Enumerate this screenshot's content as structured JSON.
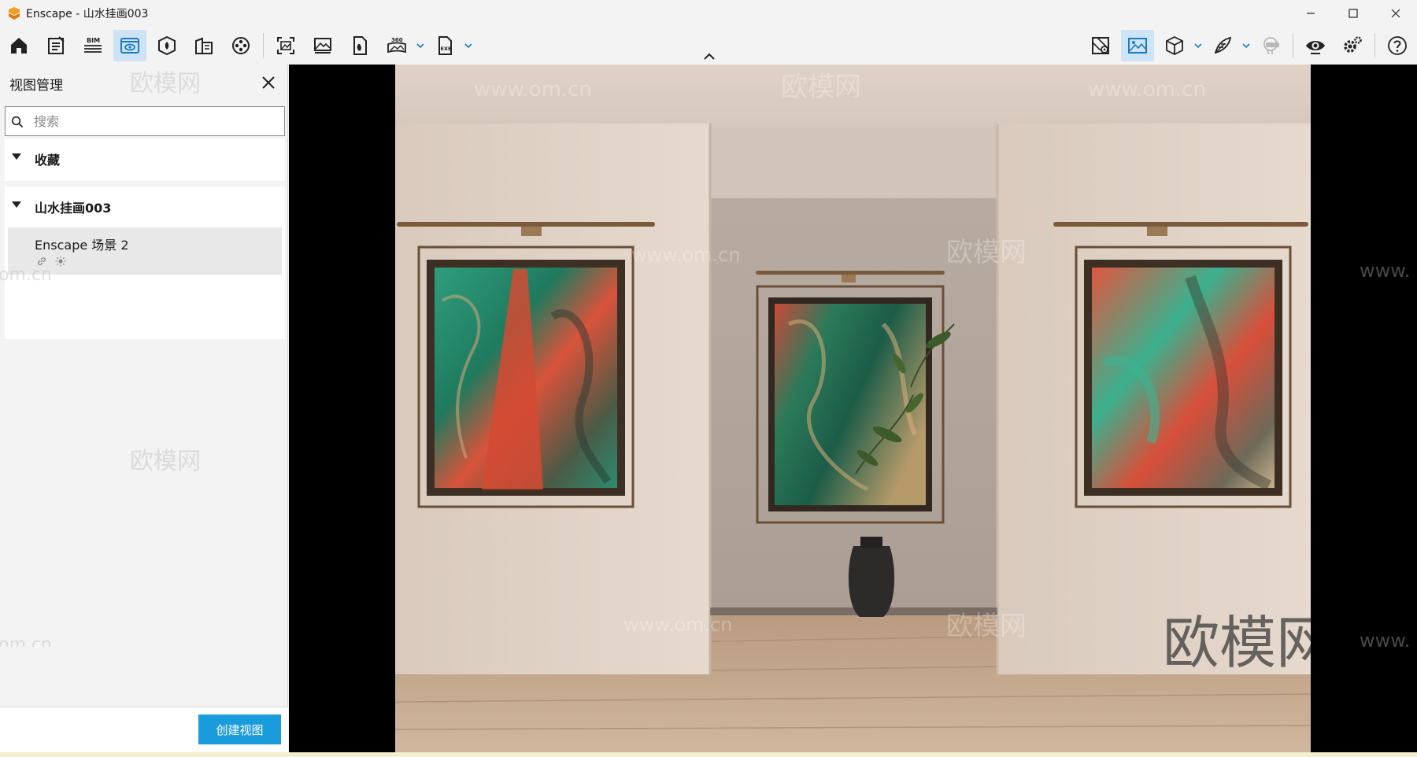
{
  "window": {
    "title": "Enscape - 山水挂画003"
  },
  "panel": {
    "title": "视图管理",
    "search_placeholder": "搜索",
    "favorites_label": "收藏",
    "project_label": "山水挂画003",
    "views": [
      {
        "name": "Enscape 场景 2"
      }
    ],
    "create_button": "创建视图"
  },
  "toolbar": {
    "icons": [
      "home-icon",
      "notes-icon",
      "bim-icon",
      "view-management-icon",
      "asset-library-icon",
      "building-icon",
      "video-editor-icon",
      "screenshot-icon",
      "batch-render-icon",
      "panorama-icon",
      "360-icon",
      "exe-export-icon",
      "map-icon",
      "visual-settings-icon",
      "cube-icon",
      "feather-icon",
      "vr-headset-icon",
      "eye-icon",
      "settings-icon",
      "help-icon"
    ],
    "bim_label": "BIM",
    "pano_label": "360",
    "exe_label": "EXE"
  },
  "watermark": {
    "brand": "欧模网",
    "url": "www.om.cn",
    "url_partial": "om.cn",
    "url_prefix": "www.",
    "big": "欧模网"
  },
  "colors": {
    "accent": "#1a9bdc",
    "active_tab_bg": "#cfe3f6",
    "logo": "#f0a020"
  }
}
